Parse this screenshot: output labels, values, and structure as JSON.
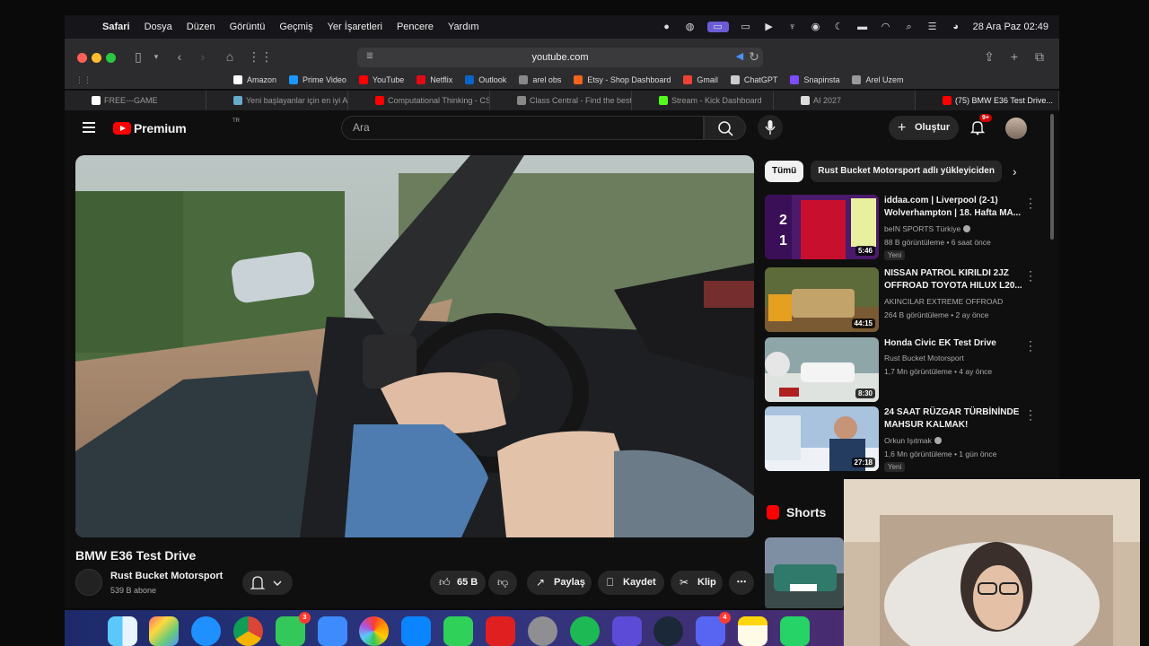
{
  "menubar": {
    "app_name": "Safari",
    "menus": [
      "Dosya",
      "Düzen",
      "Görüntü",
      "Geçmiş",
      "Yer İşaretleri",
      "Pencere",
      "Yardım"
    ],
    "clock": "28 Ara Paz  02:49"
  },
  "browser": {
    "url": "youtube.com",
    "favorites": [
      {
        "label": "Amazon",
        "color": "#ffffff"
      },
      {
        "label": "Prime Video",
        "color": "#1a98ff"
      },
      {
        "label": "YouTube",
        "color": "#ff0000"
      },
      {
        "label": "Netflix",
        "color": "#e50914"
      },
      {
        "label": "Outlook",
        "color": "#0a64c8"
      },
      {
        "label": "arel obs",
        "color": "#888888"
      },
      {
        "label": "Etsy - Shop Dashboard",
        "color": "#f1641e"
      },
      {
        "label": "Gmail",
        "color": "#ea4335"
      },
      {
        "label": "ChatGPT",
        "color": "#cccccc"
      },
      {
        "label": "Snapinsta",
        "color": "#7b4dff"
      },
      {
        "label": "Arel Uzem",
        "color": "#999999"
      }
    ],
    "tabs": [
      {
        "label": "FREE---GAME",
        "color": "#ffffff"
      },
      {
        "label": "Yeni başlayanlar için en iyi AI...",
        "color": "#6ac"
      },
      {
        "label": "Computational Thinking - CS...",
        "color": "#ff0000"
      },
      {
        "label": "Class Central - Find the best...",
        "color": "#888888"
      },
      {
        "label": "Stream - Kick Dashboard",
        "color": "#53fc18"
      },
      {
        "label": "AI 2027",
        "color": "#dddddd"
      },
      {
        "label": "(75) BMW E36 Test Drive...",
        "color": "#ff0000"
      }
    ]
  },
  "youtube": {
    "logo_text": "Premium",
    "region": "TR",
    "search_placeholder": "Ara",
    "create_label": "Oluştur",
    "notification_count": "9+",
    "video": {
      "title": "BMW E36 Test Drive",
      "channel": "Rust Bucket Motorsport",
      "subscribers": "539 B abone",
      "likes": "65 B",
      "share_label": "Paylaş",
      "save_label": "Kaydet",
      "clip_label": "Klip"
    },
    "chips": [
      "Tümü",
      "Rust Bucket Motorsport adlı yükleyiciden"
    ],
    "recommendations": [
      {
        "title": "iddaa.com | Liverpool (2-1) Wolverhampton | 18. Hafta MA...",
        "channel": "beIN SPORTS Türkiye",
        "verified": true,
        "meta": "88 B görüntüleme • 6 saat önce",
        "badge": "Yeni",
        "duration": "5:46"
      },
      {
        "title": "NISSAN PATROL KIRILDI 2JZ OFFROAD TOYOTA HILUX L20...",
        "channel": "AKINCILAR EXTREME OFFROAD",
        "verified": false,
        "meta": "264 B görüntüleme • 2 ay önce",
        "badge": "",
        "duration": "44:15"
      },
      {
        "title": "Honda Civic EK Test Drive",
        "channel": "Rust Bucket Motorsport",
        "verified": false,
        "meta": "1,7 Mn görüntüleme • 4 ay önce",
        "badge": "",
        "duration": "8:30"
      },
      {
        "title": "24 SAAT RÜZGAR TÜRBİNİNDE MAHSUR KALMAK!",
        "channel": "Orkun Işıtmak",
        "verified": true,
        "meta": "1,6 Mn görüntüleme • 1 gün önce",
        "badge": "Yeni",
        "duration": "27:18"
      }
    ],
    "shorts_label": "Shorts"
  },
  "dock": {
    "badges": {
      "messages": "3",
      "discord": "4"
    }
  }
}
